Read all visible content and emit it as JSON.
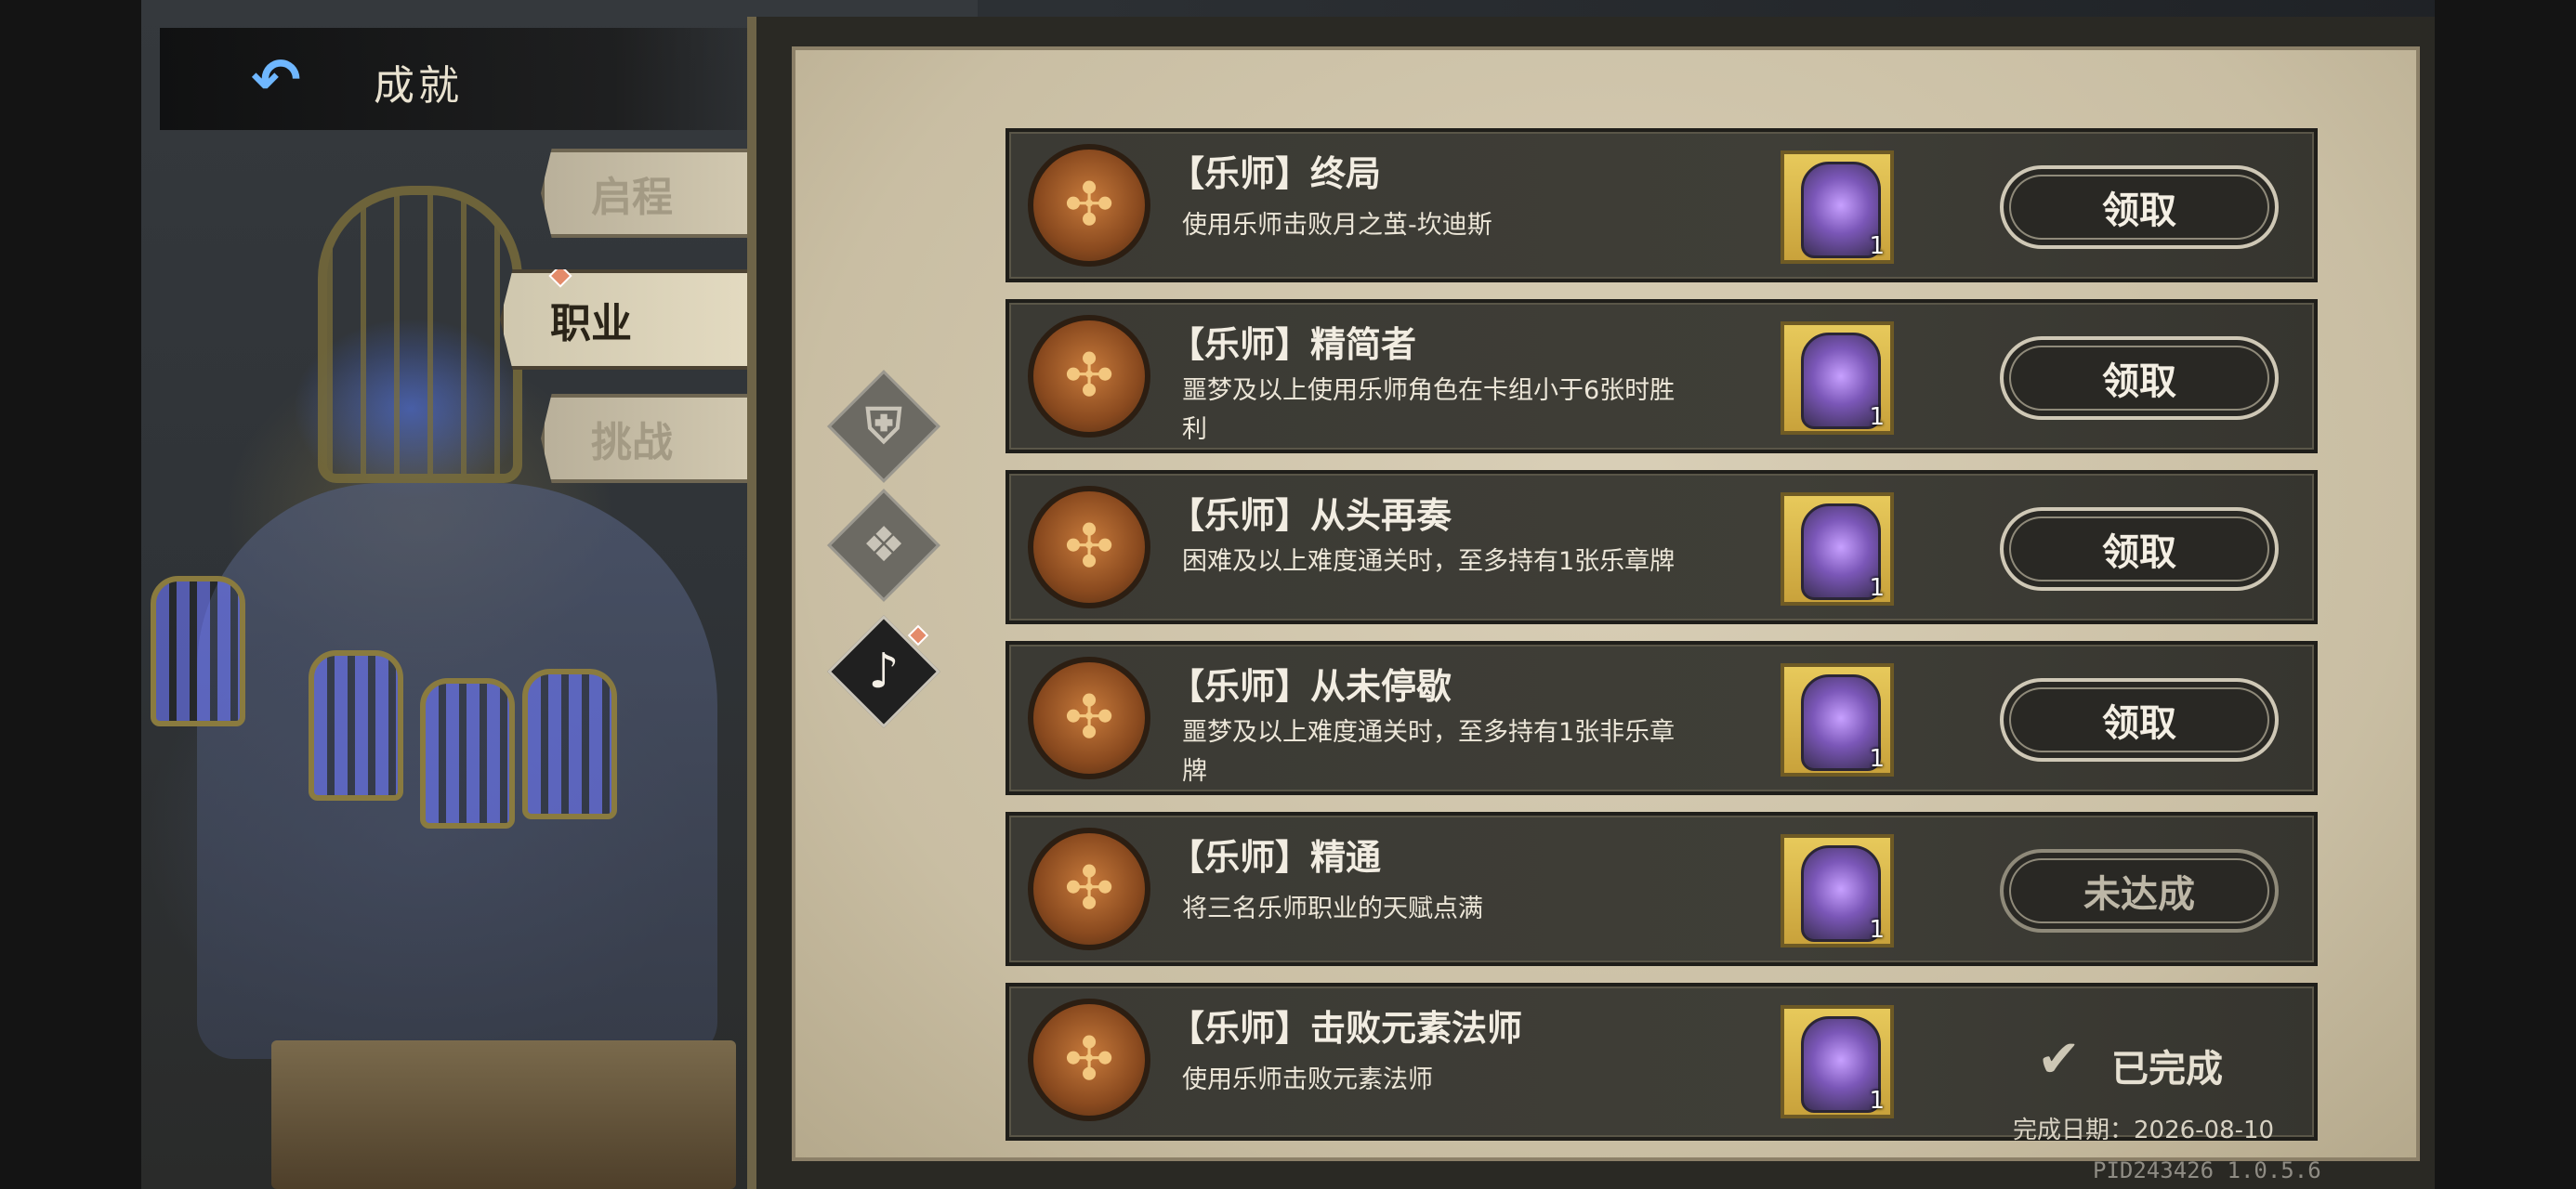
{
  "header": {
    "back_icon": "back-arrow-icon",
    "title": "成就"
  },
  "tabs": [
    {
      "label": "启程",
      "active": false
    },
    {
      "label": "职业",
      "active": true
    },
    {
      "label": "挑战",
      "active": false
    }
  ],
  "class_icons": [
    "knight-class-icon",
    "ornament-class-icon",
    "musician-class-icon"
  ],
  "achievements": [
    {
      "title": "【乐师】终局",
      "desc": "使用乐师击败月之茧-坎迪斯",
      "reward_count": "1",
      "action": "领取",
      "state": "claimable"
    },
    {
      "title": "【乐师】精简者",
      "desc": "噩梦及以上使用乐师角色在卡组小于6张时胜利",
      "reward_count": "1",
      "action": "领取",
      "state": "claimable"
    },
    {
      "title": "【乐师】从头再奏",
      "desc": "困难及以上难度通关时，至多持有1张乐章牌",
      "reward_count": "1",
      "action": "领取",
      "state": "claimable"
    },
    {
      "title": "【乐师】从未停歇",
      "desc": "噩梦及以上难度通关时，至多持有1张非乐章牌",
      "reward_count": "1",
      "action": "领取",
      "state": "claimable"
    },
    {
      "title": "【乐师】精通",
      "desc": "将三名乐师职业的天赋点满",
      "reward_count": "1",
      "action": "未达成",
      "state": "locked"
    },
    {
      "title": "【乐师】击败元素法师",
      "desc": "使用乐师击败元素法师",
      "reward_count": "1",
      "action": "已完成",
      "state": "completed",
      "date_label": "完成日期：2026-08-10"
    }
  ],
  "version": "PID243426  1.0.5.6"
}
